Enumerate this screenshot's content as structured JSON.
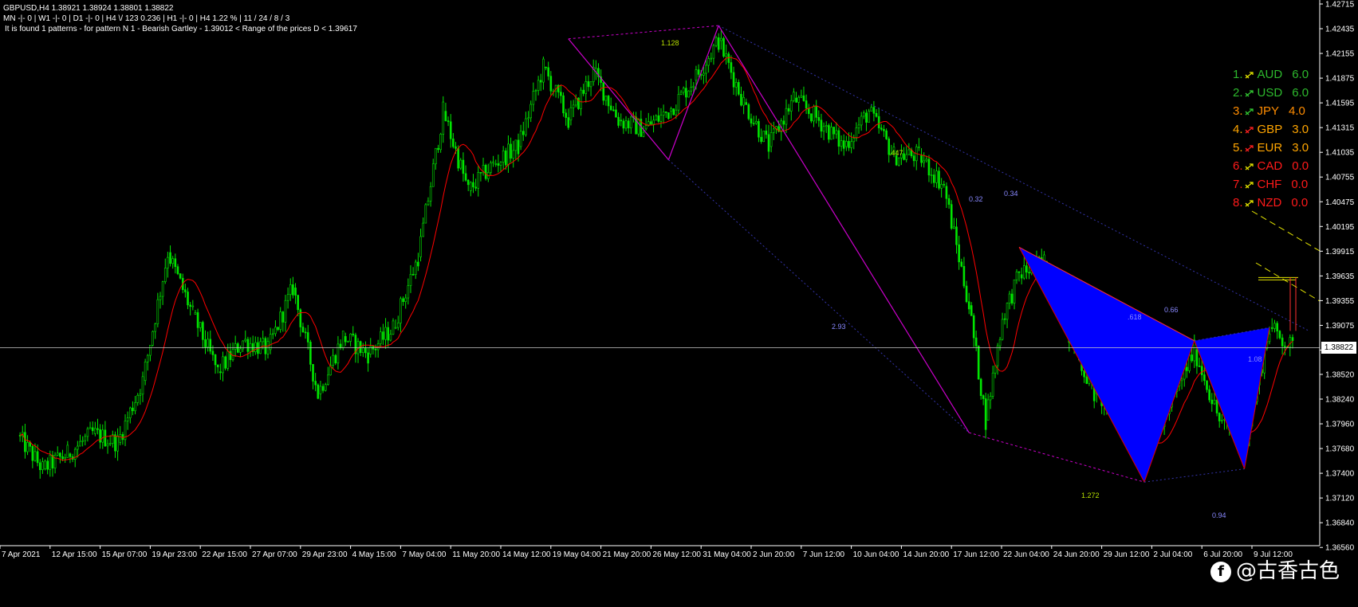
{
  "header": {
    "symbol_line": "GBPUSD,H4  1.38921 1.38924 1.38801 1.38822",
    "periods_line": "MN -|- 0  |  W1 -|- 0  |  D1 -|- 0  |  H4 \\/ 123   0.236  |  H1 -|- 0  |  H4   1.22 %  |  11 / 24 / 8 / 3",
    "pattern_line": "It is found 1 patterns  -  for pattern N 1 - Bearish Gartley - 1.39012 < Range of the prices D < 1.39617"
  },
  "currency_strength": [
    {
      "rank": "1.",
      "currency": "AUD",
      "value": "6.0",
      "color": "#2db82d",
      "arrow_color": "#e5e500"
    },
    {
      "rank": "2.",
      "currency": "USD",
      "value": "6.0",
      "color": "#2db82d",
      "arrow_color": "#33cc33"
    },
    {
      "rank": "3.",
      "currency": "JPY",
      "value": "4.0",
      "color": "#ff8c00",
      "arrow_color": "#33cc33"
    },
    {
      "rank": "4.",
      "currency": "GBP",
      "value": "3.0",
      "color": "#ffa500",
      "arrow_color": "#ff2020"
    },
    {
      "rank": "5.",
      "currency": "EUR",
      "value": "3.0",
      "color": "#ffa500",
      "arrow_color": "#ff2020"
    },
    {
      "rank": "6.",
      "currency": "CAD",
      "value": "0.0",
      "color": "#ff1a1a",
      "arrow_color": "#e5e500"
    },
    {
      "rank": "7.",
      "currency": "CHF",
      "value": "0.0",
      "color": "#ff1a1a",
      "arrow_color": "#e5e500"
    },
    {
      "rank": "8.",
      "currency": "NZD",
      "value": "0.0",
      "color": "#ff1a1a",
      "arrow_color": "#e5e500"
    }
  ],
  "current_price_label": "1.38822",
  "watermark": {
    "logo_glyph": "f",
    "text": "@古香古色"
  },
  "colors": {
    "background": "#000000",
    "candle": "#00e600",
    "moving_average": "#ff0000",
    "pattern_fill": "#0000ff",
    "zigzag": "#cc00cc",
    "axis": "#ffffff"
  },
  "chart_data": {
    "type": "candlestick",
    "symbol": "GBPUSD",
    "timeframe": "H4",
    "ylim": [
      1.3658,
      1.4276
    ],
    "y_ticks": [
      1.42715,
      1.42435,
      1.42155,
      1.41875,
      1.41595,
      1.41315,
      1.41035,
      1.40755,
      1.40475,
      1.40195,
      1.39915,
      1.39635,
      1.39355,
      1.39075,
      1.38795,
      1.3852,
      1.3824,
      1.3796,
      1.3768,
      1.374,
      1.3712,
      1.3684,
      1.3656
    ],
    "y_tick_labels": [
      "1.42715",
      "1.42435",
      "1.42155",
      "1.41875",
      "1.41595",
      "1.41315",
      "1.41035",
      "1.40755",
      "1.40475",
      "1.40195",
      "1.39915",
      "1.39635",
      "1.39355",
      "1.39075",
      "1.38795",
      "1.38520",
      "1.38240",
      "1.37960",
      "1.37680",
      "1.37400",
      "1.37120",
      "1.36840",
      "1.36560"
    ],
    "x_tick_labels": [
      "7 Apr 2021",
      "12 Apr 15:00",
      "15 Apr 07:00",
      "19 Apr 23:00",
      "22 Apr 15:00",
      "27 Apr 07:00",
      "29 Apr 23:00",
      "4 May 15:00",
      "7 May 04:00",
      "11 May 20:00",
      "14 May 12:00",
      "19 May 04:00",
      "21 May 20:00",
      "26 May 12:00",
      "31 May 04:00",
      "2 Jun 20:00",
      "7 Jun 12:00",
      "10 Jun 04:00",
      "14 Jun 20:00",
      "17 Jun 12:00",
      "22 Jun 04:00",
      "24 Jun 20:00",
      "29 Jun 12:00",
      "2 Jul 04:00",
      "6 Jul 20:00",
      "9 Jul 12:00"
    ],
    "current_price": 1.38822,
    "price_path": [
      {
        "x": "7 Apr 2021",
        "y": 1.3783
      },
      {
        "x": "9 Apr 2021",
        "y": 1.3745
      },
      {
        "x": "12 Apr 15:00",
        "y": 1.3762
      },
      {
        "x": "13 Apr 2021",
        "y": 1.3785
      },
      {
        "x": "15 Apr 07:00",
        "y": 1.3775
      },
      {
        "x": "16 Apr 2021",
        "y": 1.3845
      },
      {
        "x": "19 Apr 23:00",
        "y": 1.399
      },
      {
        "x": "21 Apr 2021",
        "y": 1.392
      },
      {
        "x": "22 Apr 15:00",
        "y": 1.3855
      },
      {
        "x": "23 Apr 2021",
        "y": 1.389
      },
      {
        "x": "27 Apr 07:00",
        "y": 1.388
      },
      {
        "x": "28 Apr 2021",
        "y": 1.395
      },
      {
        "x": "29 Apr 23:00",
        "y": 1.383
      },
      {
        "x": "3 May 2021",
        "y": 1.3895
      },
      {
        "x": "4 May 15:00",
        "y": 1.3875
      },
      {
        "x": "5 May 2021",
        "y": 1.3905
      },
      {
        "x": "7 May 04:00",
        "y": 1.3985
      },
      {
        "x": "7 May 2021 20:00",
        "y": 1.415
      },
      {
        "x": "11 May 20:00",
        "y": 1.406
      },
      {
        "x": "13 May 2021",
        "y": 1.409
      },
      {
        "x": "14 May 12:00",
        "y": 1.411
      },
      {
        "x": "17 May 2021",
        "y": 1.42
      },
      {
        "x": "19 May 04:00",
        "y": 1.414
      },
      {
        "x": "20 May 2021",
        "y": 1.4195
      },
      {
        "x": "21 May 20:00",
        "y": 1.414
      },
      {
        "x": "24 May 2021",
        "y": 1.413
      },
      {
        "x": "26 May 12:00",
        "y": 1.415
      },
      {
        "x": "28 May 2021",
        "y": 1.4185
      },
      {
        "x": "31 May 04:00",
        "y": 1.423
      },
      {
        "x": "1 Jun 2021",
        "y": 1.416
      },
      {
        "x": "2 Jun 20:00",
        "y": 1.411
      },
      {
        "x": "4 Jun 2021",
        "y": 1.4165
      },
      {
        "x": "7 Jun 12:00",
        "y": 1.414
      },
      {
        "x": "9 Jun 2021",
        "y": 1.411
      },
      {
        "x": "10 Jun 04:00",
        "y": 1.415
      },
      {
        "x": "11 Jun 2021",
        "y": 1.41
      },
      {
        "x": "14 Jun 20:00",
        "y": 1.41
      },
      {
        "x": "16 Jun 2021",
        "y": 1.4065
      },
      {
        "x": "17 Jun 12:00",
        "y": 1.393
      },
      {
        "x": "18 Jun 2021",
        "y": 1.38
      },
      {
        "x": "21 Jun 2021",
        "y": 1.3915
      },
      {
        "x": "22 Jun 04:00",
        "y": 1.3965
      },
      {
        "x": "23 Jun 2021",
        "y": 1.398
      },
      {
        "x": "24 Jun 20:00",
        "y": 1.3895
      },
      {
        "x": "28 Jun 2021",
        "y": 1.383
      },
      {
        "x": "29 Jun 12:00",
        "y": 1.381
      },
      {
        "x": "1 Jul 2021",
        "y": 1.376
      },
      {
        "x": "2 Jul 04:00",
        "y": 1.3815
      },
      {
        "x": "5 Jul 2021",
        "y": 1.388
      },
      {
        "x": "6 Jul 20:00",
        "y": 1.38
      },
      {
        "x": "8 Jul 2021",
        "y": 1.377
      },
      {
        "x": "9 Jul 12:00",
        "y": 1.3905
      },
      {
        "x": "12 Jul 2021",
        "y": 1.3882
      }
    ],
    "pattern": {
      "name": "Bearish Gartley",
      "points": [
        {
          "x": "17 Jun 12:00",
          "y": 1.3786
        },
        {
          "x": "22 Jun 04:00",
          "y": 1.3996
        },
        {
          "x": "1 Jul 2021",
          "y": 1.373
        },
        {
          "x": "5 Jul 2021",
          "y": 1.389
        },
        {
          "x": "8 Jul 2021",
          "y": 1.3745
        },
        {
          "x": "9 Jul 12:00",
          "y": 1.3905
        }
      ],
      "ratio_labels": [
        {
          "text": "0.32",
          "color": "#8888ff"
        },
        {
          "text": "0.34",
          "color": "#8888ff"
        },
        {
          "text": ".618",
          "color": "#8888ff"
        },
        {
          "text": "0.66",
          "color": "#8888ff"
        },
        {
          "text": "1.08",
          "color": "#8888ff"
        },
        {
          "text": "1.272",
          "color": "#b8e000"
        },
        {
          "text": "0.94",
          "color": "#8888ff"
        }
      ]
    },
    "prior_pattern": {
      "points": [
        {
          "x": "19 May 04:00",
          "y": 1.4232
        },
        {
          "x": "26 May 12:00",
          "y": 1.4095
        },
        {
          "x": "31 May 04:00",
          "y": 1.4247
        },
        {
          "x": "17 Jun 12:00",
          "y": 1.3786
        }
      ],
      "ratio_labels": [
        {
          "text": "1.128",
          "color": "#b8e000"
        },
        {
          "text": "2.93",
          "color": "#8888ff"
        },
        {
          "text": ".447",
          "color": "#b8e000"
        }
      ]
    },
    "target_zone": {
      "low": 1.39012,
      "high": 1.39617
    }
  }
}
